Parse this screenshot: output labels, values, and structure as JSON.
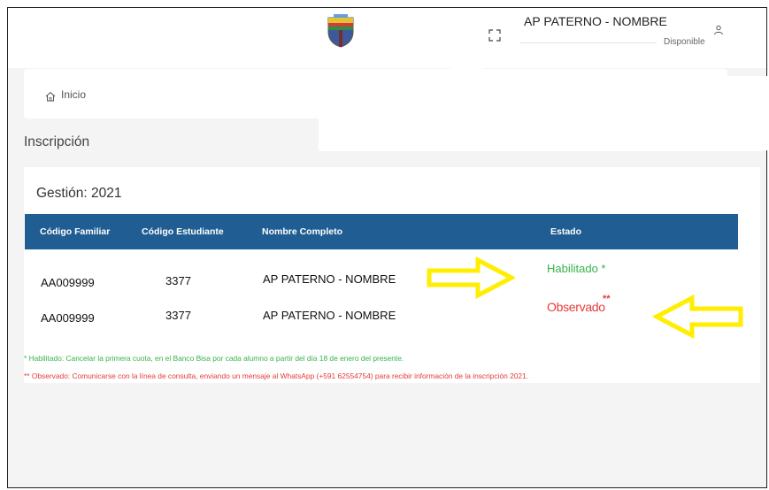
{
  "header": {
    "user_name": "AP PATERNO - NOMBRE",
    "user_status": "Disponible",
    "icons": [
      "school-crest-logo",
      "fullscreen-icon",
      "user-icon"
    ]
  },
  "breadcrumb": {
    "label": "Inicio",
    "icon": "home-icon"
  },
  "page": {
    "title": "Inscripción"
  },
  "card": {
    "gestion_label": "Gestión: 2021",
    "table": {
      "columns": [
        "Código Familiar",
        "Código Estudiante",
        "Nombre Completo",
        "Estado"
      ],
      "rows": [
        [
          "AA009999",
          "3377",
          "AP PATERNO - NOMBRE",
          "Habilitado *"
        ],
        [
          "AA009999",
          "3377",
          "AP PATERNO - NOMBRE",
          "Observado"
        ]
      ],
      "observado_marker": "**"
    },
    "notes": [
      "* Habilitado: Cancelar la primera cuota, en el Banco Bisa por cada alumno a partir del día 18 de enero del presente.",
      "** Observado: Comunicarse con la línea de consulta, enviando un mensaje al WhatsApp (+591 62554754) para recibir información de la inscripción 2021."
    ]
  },
  "colors": {
    "table_header": "#1f5d92",
    "habilitado": "#36b34a",
    "observado": "#e63b3b",
    "annotation_arrow": "#ffee00"
  }
}
